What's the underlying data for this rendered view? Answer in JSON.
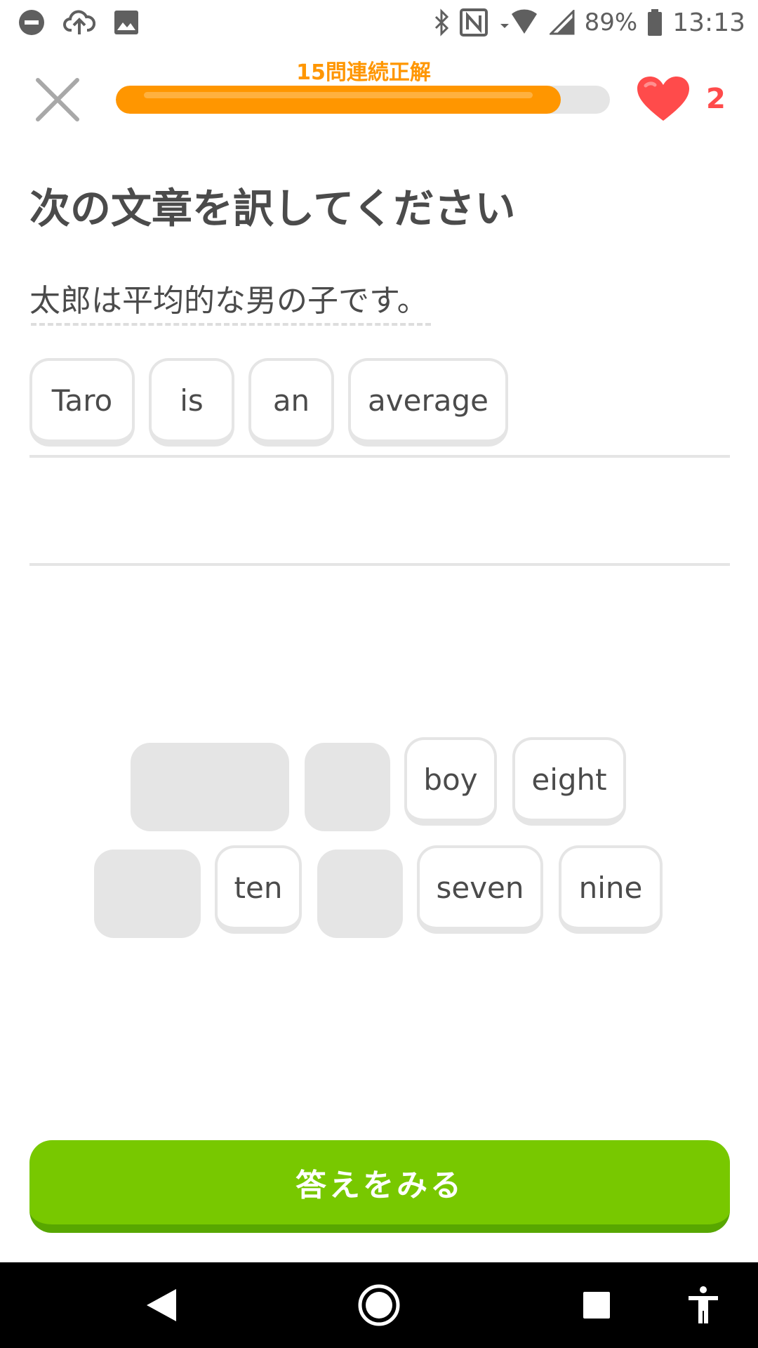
{
  "status_bar": {
    "battery_percent": "89%",
    "time": "13:13",
    "icons": [
      "dnd-icon",
      "cloud-upload-icon",
      "image-icon",
      "bluetooth-icon",
      "nfc-icon",
      "wifi-icon",
      "signal-icon",
      "battery-icon"
    ]
  },
  "header": {
    "close_icon": "close-icon",
    "streak_label": "15問連続正解",
    "progress_fraction": 0.9,
    "hearts_count": "2",
    "heart_color": "#ff4b4b",
    "accent_color": "#ff9600"
  },
  "exercise": {
    "title": "次の文章を訳してください",
    "prompt": "太郎は平均的な男の子です。",
    "selected_words": [
      "Taro",
      "is",
      "an",
      "average"
    ],
    "word_bank": {
      "row1": [
        "",
        "",
        "boy",
        "eight"
      ],
      "row2": [
        "",
        "ten",
        "",
        "seven",
        "nine"
      ]
    }
  },
  "footer": {
    "button_label": "答えをみる",
    "button_color": "#78c800"
  },
  "navbar": {
    "items": [
      "back-icon",
      "home-icon",
      "recents-icon",
      "accessibility-icon"
    ]
  }
}
